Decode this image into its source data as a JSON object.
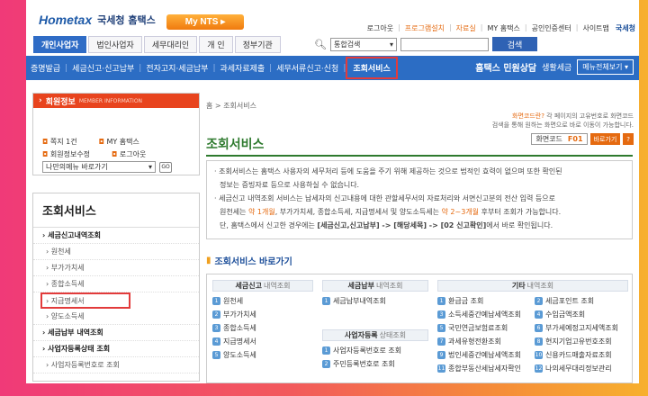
{
  "header": {
    "logo_text": "Hometax",
    "logo_sub": "국세청 홈택스",
    "mynts": "My NTS"
  },
  "toplinks": [
    "로그아웃",
    "프로그램설치",
    "자료실",
    "MY 홈택스",
    "공인인증센터",
    "사이트맵",
    "국세청"
  ],
  "tabs": [
    "개인사업자",
    "법인사업자",
    "세무대리인",
    "개 인",
    "정부기관"
  ],
  "search": {
    "select": "통합검색",
    "button": "검색"
  },
  "nav": {
    "items": [
      "증명발급",
      "세금신고·신고납부",
      "전자고지·세금납부",
      "과세자료제출",
      "세무서류신고·신청",
      "조회서비스"
    ],
    "right1": "홈택스 민원상담",
    "right2": "생활세금",
    "menu_btn": "메뉴전체보기"
  },
  "member": {
    "title": "회원정보",
    "title_en": "MEMBER INFORMATION",
    "row1_a": "쪽지 1건",
    "row1_b": "MY 홈택스",
    "row2_a": "회원정보수정",
    "row2_b": "로그아웃",
    "mymenu": "나만의메뉴 바로가기",
    "go": "GO"
  },
  "lnav": {
    "title": "조회서비스",
    "items": [
      {
        "label": "세금신고내역조회",
        "type": "main"
      },
      {
        "label": "원천세",
        "type": "sub"
      },
      {
        "label": "부가가치세",
        "type": "sub"
      },
      {
        "label": "종합소득세",
        "type": "sub"
      },
      {
        "label": "지급명세서",
        "type": "hl"
      },
      {
        "label": "양도소득세",
        "type": "sub"
      },
      {
        "label": "세금납부 내역조회",
        "type": "main"
      },
      {
        "label": "사업자등록상태 조회",
        "type": "main"
      },
      {
        "label": "사업자등록번호로 조회",
        "type": "sub"
      }
    ]
  },
  "main": {
    "breadcrumb": "홈 > 조회서비스",
    "note1_o": "화면코드란?",
    "note1": "각 페이지의 고유번호로 화면코드",
    "note2": "검색을 통해 원하는 화면으로 바로 이동이 가능합니다.",
    "pageno_label": "화면코드",
    "pageno_code": "F01",
    "pageno_btn": "바로가기",
    "title": "조회서비스",
    "desc1": "· 조회서비스는 홈택스 사용자의 세무처리 등에 도움을 주기 위해 제공하는 것으로 법적인 효력이 없으며 또한 확인된",
    "desc2": "정보는 증빙자료 등으로 사용하실 수 없습니다.",
    "desc3": "· 세금신고 내역조회 서비스는 납세자의 신고내용에 대한 관할세무서의 자료처리와 서면신고분의 전산 입력 등으로",
    "desc4a": "원천세는",
    "desc4b": "약 1개월",
    "desc4c": ", 부가가치세, 종합소득세, 지급명세서 및 양도소득세는",
    "desc4d": "약 2~3개월",
    "desc4e": "후부터 조회가 가능합니다.",
    "desc5a": "단, 홈택스에서 신고한 경우에는",
    "desc5b": "[세금신고,신고납부] -> [해당세목] -> [02 신고확인]",
    "desc5c": "에서 바로 확인됩니다.",
    "shortcut": "조회서비스 바로가기"
  },
  "shortcut_cols": {
    "c1_head": "세금신고",
    "c1_sub": "내역조회",
    "c1": [
      "원천세",
      "부가가치세",
      "종합소득세",
      "지급명세서",
      "양도소득세"
    ],
    "c2_head": "세금납부",
    "c2_sub": "내역조회",
    "c2": [
      "세금납부내역조회"
    ],
    "c3_head": "사업자등록",
    "c3_sub": "상태조회",
    "c3": [
      "사업자등록번호로 조회",
      "주민등록번호로 조회"
    ],
    "c4_head": "기타",
    "c4_sub": "내역조회",
    "c4a": [
      "환급금 조회",
      "소득세중간예납세액조회",
      "국민연금보험료조회",
      "과세유형전환조회",
      "법인세중간예납세액조회",
      "종합부동산세납세자확인"
    ],
    "c4b": [
      "세금포인트 조회",
      "수입금액조회",
      "부가세예정고지세액조회",
      "현지기업고유번호조회",
      "신용카드매출자료조회",
      "나의세무대리정보관리"
    ]
  }
}
